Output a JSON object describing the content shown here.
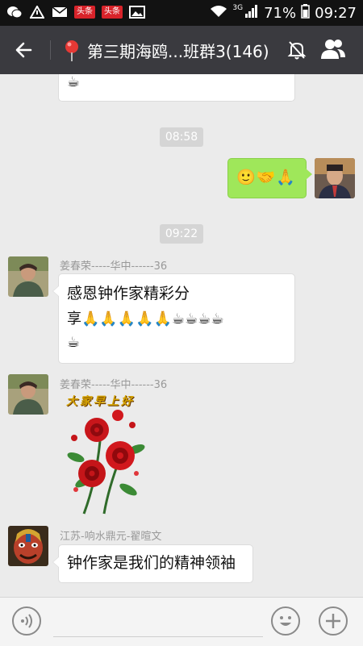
{
  "status_bar": {
    "badge1": "头条",
    "badge2": "头条",
    "network": "3G",
    "battery": "71%",
    "time": "09:27"
  },
  "header": {
    "title": "第三期海鸥...班群3(146)"
  },
  "messages": {
    "top_partial_emoji": "☕",
    "time1": "08:58",
    "self_emojis": "🙂🤝🙏",
    "time2": "09:22",
    "msg1_sender": "姜春荣-----华中------36",
    "msg1_line1": "感恩钟作家精彩分",
    "msg1_line2": "享🙏🙏🙏🙏🙏☕☕☕☕",
    "msg1_line3": "☕",
    "msg2_sender": "姜春荣-----华中------36",
    "msg2_sticker_text": "大家早上好",
    "msg3_sender": "江苏-响水鼎元-翟暄文",
    "msg3_text": "钟作家是我们的精神领袖"
  },
  "colors": {
    "nav_bg": "#3a3a3f",
    "self_bubble": "#9fe75a",
    "chat_bg": "#ebebeb"
  }
}
